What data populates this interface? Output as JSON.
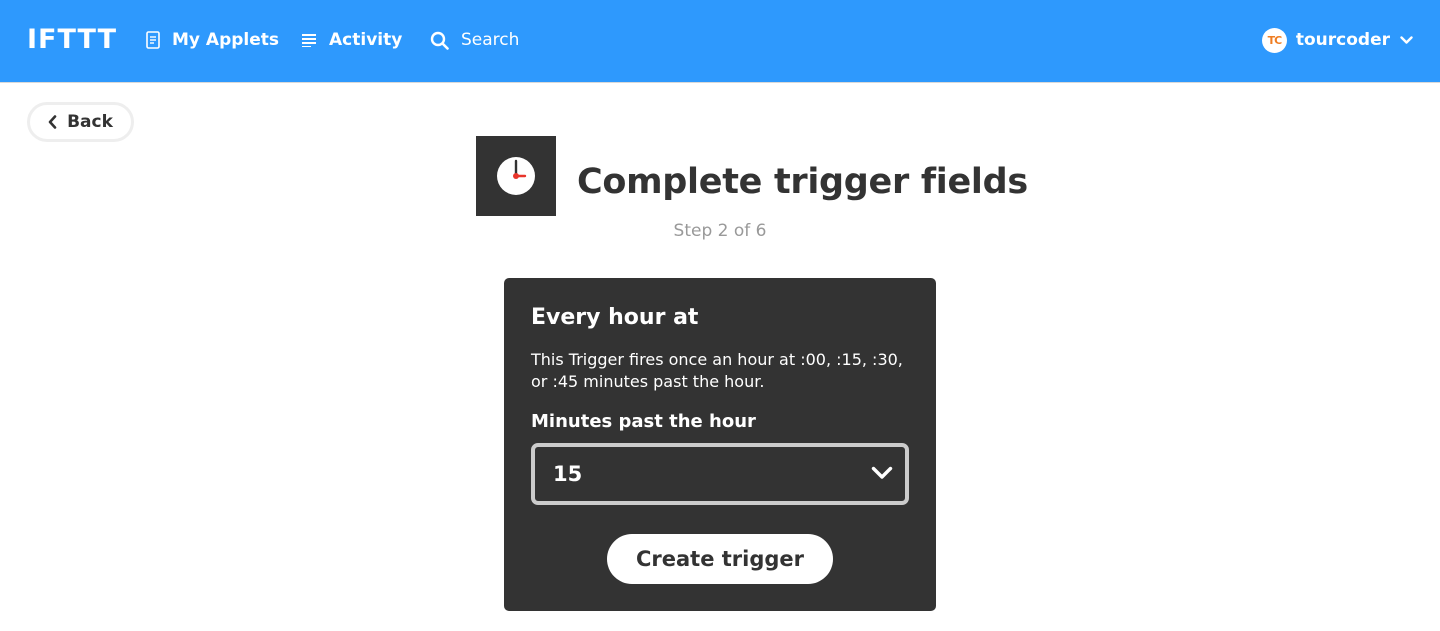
{
  "header": {
    "logo": "IFTTT",
    "nav": {
      "my_applets": "My Applets",
      "activity": "Activity",
      "search": "Search"
    },
    "user": {
      "initials": "TC",
      "username": "tourcoder"
    }
  },
  "back_button": {
    "label": "Back"
  },
  "page": {
    "title": "Complete trigger fields",
    "step": "Step 2 of 6"
  },
  "trigger": {
    "title": "Every hour at",
    "description": "This Trigger fires once an hour at :00, :15, :30, or :45 minutes past the hour.",
    "field_label": "Minutes past the hour",
    "selected_value": "15",
    "submit_label": "Create trigger"
  },
  "colors": {
    "brand_blue": "#2e99fd",
    "card_dark": "#333333",
    "clock_hand_red": "#e8352b"
  }
}
